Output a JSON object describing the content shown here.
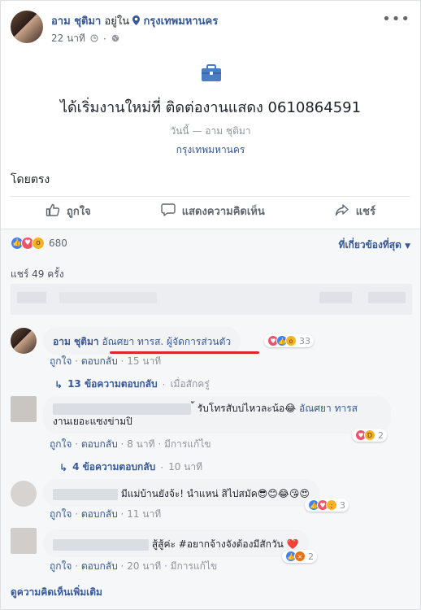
{
  "post": {
    "author": "อาม ชุติมา",
    "at_text": "อยู่ใน",
    "location": "กรุงเทพมหานคร",
    "time": "22 นาที",
    "life_event_title": "ได้เริ่มงานใหม่ที่ ติดต่องานแสดง 0610864591",
    "life_event_sub": "วันนี้ — อาม ชุติมา",
    "life_event_location": "กรุงเทพมหานคร",
    "text": "โดยตรง"
  },
  "actions": {
    "like": "ถูกใจ",
    "comment": "แสดงความคิดเห็น",
    "share": "แชร์"
  },
  "stats": {
    "reaction_count": "680",
    "shares": "แชร์ 49 ครั้ง",
    "sort": "ที่เกี่ยวข้องที่สุด"
  },
  "comments": [
    {
      "name": "อาม ชุติมา",
      "tag": "อัณศยา ทารส. ผู้จัดการส่วนตัว",
      "like": "ถูกใจ",
      "reply": "ตอบกลับ",
      "time": "15 นาที",
      "reactions": "33",
      "replies": "13 ข้อความตอบกลับ",
      "replies_time": "เมื่อสักครู่"
    },
    {
      "line1_tail": "้ รับโทรสับบ่ไหวละน้อ😂",
      "tag": "อัณศยา ทารส",
      "line2": "งานเยอะแซงข่ามปิ",
      "like": "ถูกใจ",
      "reply": "ตอบกลับ",
      "time": "8 นาที",
      "edited": "มีการแก้ไข",
      "reactions": "2",
      "replies": "4 ข้อความตอบกลับ",
      "replies_time": "10 นาที"
    },
    {
      "text_tail": "มีแม่บ้านยังจ้ะ! นำแหน่ สิไปสมัค😎😊😂😘😍",
      "like": "ถูกใจ",
      "reply": "ตอบกลับ",
      "time": "11 นาที",
      "reactions": "3"
    },
    {
      "text_tail": "สู้สู้ค่ะ #อยากจ้างจังต้องมีสักวัน ❤️",
      "like": "ถูกใจ",
      "reply": "ตอบกลับ",
      "time": "20 นาที",
      "edited": "มีการแก้ไข",
      "reactions": "2"
    }
  ],
  "more_comments": "ดูความคิดเห็นเพิ่มเติม",
  "colors": {
    "link": "#365899",
    "like": "#4080ff",
    "love": "#f25268",
    "underline": "#e0242e"
  }
}
